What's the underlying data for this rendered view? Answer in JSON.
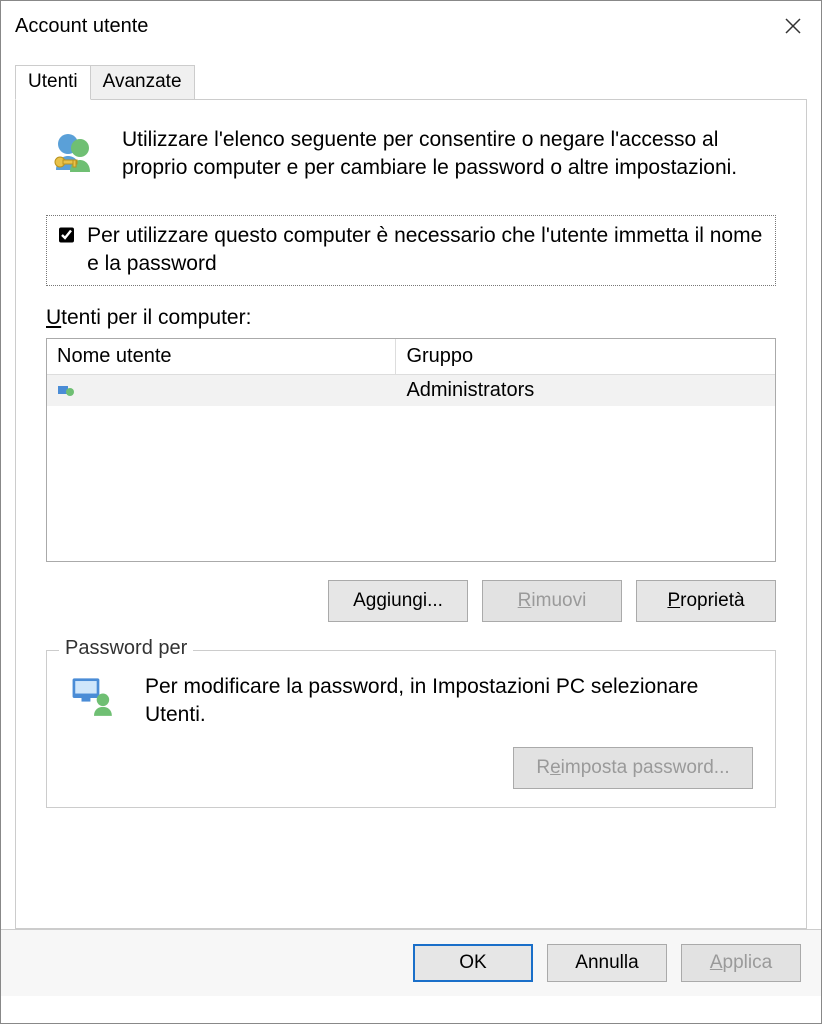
{
  "window": {
    "title": "Account utente"
  },
  "tabs": {
    "users": "Utenti",
    "advanced": "Avanzate"
  },
  "intro": {
    "text": "Utilizzare l'elenco seguente per consentire o negare l'accesso al proprio computer e per cambiare le password o altre impostazioni."
  },
  "checkbox": {
    "label": "Per utilizzare questo computer è necessario che l'utente immetta il nome e la password",
    "checked": true
  },
  "list": {
    "label": "Utenti per il computer:",
    "columns": {
      "username": "Nome utente",
      "group": "Gruppo"
    },
    "rows": [
      {
        "username": "",
        "group": "Administrators"
      }
    ]
  },
  "buttons": {
    "add": "Aggiungi...",
    "remove": "Rimuovi",
    "properties": "Proprietà",
    "reset_password": "Reimposta password...",
    "ok": "OK",
    "cancel": "Annulla",
    "apply": "Applica"
  },
  "password_group": {
    "legend": "Password per",
    "text": "Per modificare la password, in Impostazioni PC selezionare Utenti."
  }
}
